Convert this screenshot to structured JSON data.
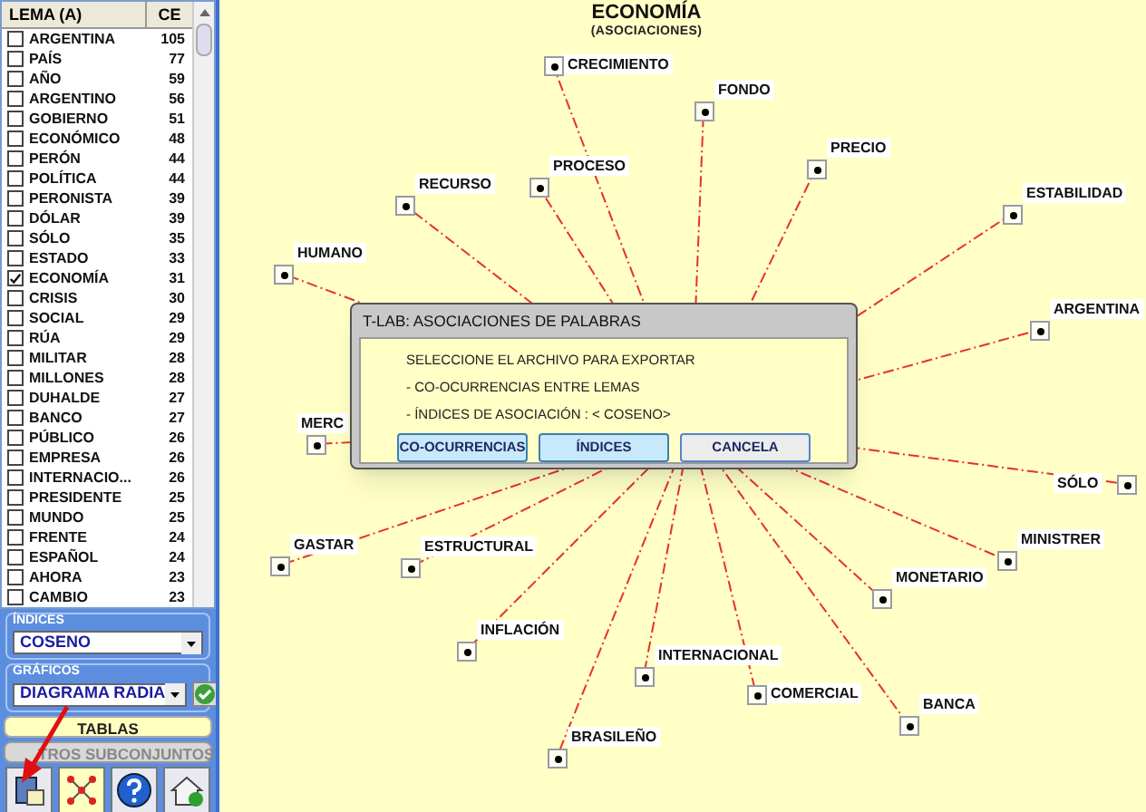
{
  "sidebar": {
    "list": {
      "columns": [
        "LEMA (A)",
        "CE"
      ],
      "rows": [
        {
          "label": "ARGENTINA",
          "count": "105",
          "checked": false
        },
        {
          "label": "PAÍS",
          "count": "77",
          "checked": false
        },
        {
          "label": "AÑO",
          "count": "59",
          "checked": false
        },
        {
          "label": "ARGENTINO",
          "count": "56",
          "checked": false
        },
        {
          "label": "GOBIERNO",
          "count": "51",
          "checked": false
        },
        {
          "label": "ECONÓMICO",
          "count": "48",
          "checked": false
        },
        {
          "label": "PERÓN",
          "count": "44",
          "checked": false
        },
        {
          "label": "POLÍTICA",
          "count": "44",
          "checked": false
        },
        {
          "label": "PERONISTA",
          "count": "39",
          "checked": false
        },
        {
          "label": "DÓLAR",
          "count": "39",
          "checked": false
        },
        {
          "label": "SÓLO",
          "count": "35",
          "checked": false
        },
        {
          "label": "ESTADO",
          "count": "33",
          "checked": false
        },
        {
          "label": "ECONOMÍA",
          "count": "31",
          "checked": true
        },
        {
          "label": "CRISIS",
          "count": "30",
          "checked": false
        },
        {
          "label": "SOCIAL",
          "count": "29",
          "checked": false
        },
        {
          "label": "RÚA",
          "count": "29",
          "checked": false
        },
        {
          "label": "MILITAR",
          "count": "28",
          "checked": false
        },
        {
          "label": "MILLONES",
          "count": "28",
          "checked": false
        },
        {
          "label": "DUHALDE",
          "count": "27",
          "checked": false
        },
        {
          "label": "BANCO",
          "count": "27",
          "checked": false
        },
        {
          "label": "PÚBLICO",
          "count": "26",
          "checked": false
        },
        {
          "label": "EMPRESA",
          "count": "26",
          "checked": false
        },
        {
          "label": "INTERNACIO...",
          "count": "26",
          "checked": false
        },
        {
          "label": "PRESIDENTE",
          "count": "25",
          "checked": false
        },
        {
          "label": "MUNDO",
          "count": "25",
          "checked": false
        },
        {
          "label": "FRENTE",
          "count": "24",
          "checked": false
        },
        {
          "label": "ESPAÑOL",
          "count": "24",
          "checked": false
        },
        {
          "label": "AHORA",
          "count": "23",
          "checked": false
        },
        {
          "label": "CAMBIO",
          "count": "23",
          "checked": false
        }
      ]
    },
    "indices": {
      "legend": "ÍNDICES",
      "value": "COSENO"
    },
    "graficos": {
      "legend": "GRÁFICOS",
      "value": "DIAGRAMA RADIA"
    },
    "buttons": [
      {
        "label": "TABLAS",
        "disabled": false
      },
      {
        "label": "TROS SUBCONJUNTOS",
        "disabled": true
      }
    ]
  },
  "chart": {
    "title": "ECONOMÍA",
    "subtitle": "(ASOCIACIONES)",
    "nodes": [
      {
        "label": "CRECIMIENTO"
      },
      {
        "label": "FONDO"
      },
      {
        "label": "PRECIO"
      },
      {
        "label": "PROCESO"
      },
      {
        "label": "RECURSO"
      },
      {
        "label": "ESTABILIDAD"
      },
      {
        "label": "HUMANO"
      },
      {
        "label": "ARGENTINA"
      },
      {
        "label": "MERC"
      },
      {
        "label": "SÓLO"
      },
      {
        "label": "MINISTRER"
      },
      {
        "label": "GASTAR"
      },
      {
        "label": "ESTRUCTURAL"
      },
      {
        "label": "MONETARIO"
      },
      {
        "label": "INFLACIÓN"
      },
      {
        "label": "INTERNACIONAL"
      },
      {
        "label": "COMERCIAL"
      },
      {
        "label": "BANCA"
      },
      {
        "label": "BRASILEÑO"
      }
    ]
  },
  "dialog": {
    "title": "T-LAB: ASOCIACIONES DE PALABRAS",
    "lines": [
      "SELECCIONE EL ARCHIVO PARA EXPORTAR",
      "- CO-OCURRENCIAS ENTRE LEMAS",
      "- ÍNDICES DE ASOCIACIÓN : < COSENO>"
    ],
    "buttons": [
      {
        "label": "CO-OCURRENCIAS",
        "kind": "blue"
      },
      {
        "label": "ÍNDICES",
        "kind": "blue"
      },
      {
        "label": "CANCELA",
        "kind": "plain"
      }
    ]
  }
}
